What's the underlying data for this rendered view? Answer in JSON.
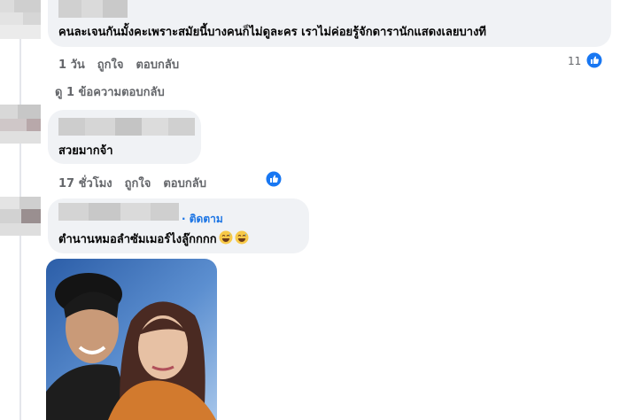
{
  "comments": [
    {
      "text": "คนละเจนกันมั้งคะเพราะสมัยนี้บางคนก็ไม่ดูละคร เราไม่ค่อยรู้จักดารานักแสดงเลยบางที",
      "time": "1 วัน",
      "like_label": "ถูกใจ",
      "reply_label": "ตอบกลับ",
      "like_count": "11",
      "view_replies": "ดู 1 ข้อความตอบกลับ"
    },
    {
      "text": "สวยมากจ้า",
      "time": "17 ชั่วโมง",
      "like_label": "ถูกใจ",
      "reply_label": "ตอบกลับ"
    },
    {
      "follow_label": "· ติดตาม",
      "text": "ตำนานหมอลำซัมเมอร์ไงลู๊กกกก",
      "emoji": [
        "grinning-sweat-emoji",
        "grinning-sweat-emoji"
      ]
    }
  ],
  "colors": {
    "bubble": "#f0f2f5",
    "meta_text": "#65676b",
    "link_blue": "#1b74e4",
    "like_blue": "#1877f2"
  }
}
